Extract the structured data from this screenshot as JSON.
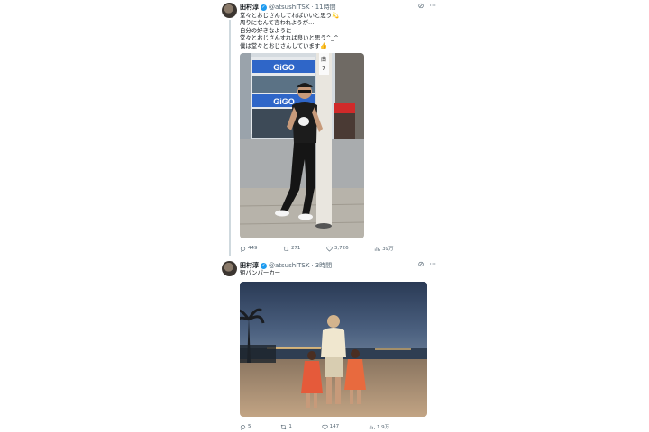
{
  "tweets": [
    {
      "author": "田村淳",
      "handle": "@atsushiTSK",
      "time": "11時間",
      "lines": [
        "堂々とおじさんしてればいいと思う💫",
        "周りになんて言われようが…",
        "自分の好きなように",
        "堂々とおじさんすれば良いと思う^_^",
        "僕は堂々とおじさんしています👍"
      ],
      "photo_signs": {
        "store": "GiGO",
        "pole": "南\n7"
      },
      "stats": {
        "replies": "449",
        "reposts": "271",
        "likes": "3,726",
        "views": "39万"
      }
    },
    {
      "author": "田村淳",
      "handle": "@atsushiTSK",
      "time": "3時間",
      "lines": [
        "短パンパーカー"
      ],
      "stats": {
        "replies": "5",
        "reposts": "1",
        "likes": "147",
        "views": "1.9万"
      }
    }
  ]
}
